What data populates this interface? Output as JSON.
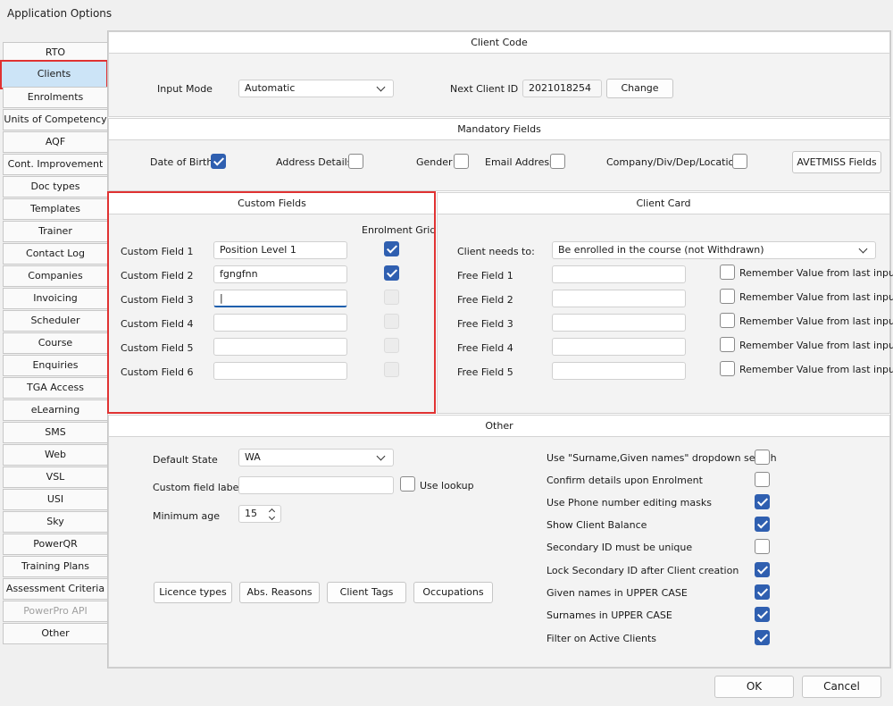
{
  "window": {
    "title": "Application Options"
  },
  "sidebar": {
    "items": [
      {
        "label": "RTO"
      },
      {
        "label": "Clients"
      },
      {
        "label": "Enrolments"
      },
      {
        "label": "Units of Competency"
      },
      {
        "label": "AQF"
      },
      {
        "label": "Cont. Improvement"
      },
      {
        "label": "Doc types"
      },
      {
        "label": "Templates"
      },
      {
        "label": "Trainer"
      },
      {
        "label": "Contact Log"
      },
      {
        "label": "Companies"
      },
      {
        "label": "Invoicing"
      },
      {
        "label": "Scheduler"
      },
      {
        "label": "Course"
      },
      {
        "label": "Enquiries"
      },
      {
        "label": "TGA Access"
      },
      {
        "label": "eLearning"
      },
      {
        "label": "SMS"
      },
      {
        "label": "Web"
      },
      {
        "label": "VSL"
      },
      {
        "label": "USI"
      },
      {
        "label": "Sky"
      },
      {
        "label": "PowerQR"
      },
      {
        "label": "Training Plans"
      },
      {
        "label": "Assessment Criteria"
      },
      {
        "label": "PowerPro API"
      },
      {
        "label": "Other"
      }
    ],
    "active": "Clients",
    "disabled": "PowerPro API"
  },
  "client_code": {
    "title": "Client Code",
    "input_mode_label": "Input Mode",
    "input_mode_value": "Automatic",
    "next_id_label": "Next Client ID",
    "next_id_value": "2021018254",
    "change_button": "Change"
  },
  "mandatory": {
    "title": "Mandatory Fields",
    "fields": [
      {
        "label": "Date of Birth",
        "checked": true
      },
      {
        "label": "Address Details",
        "checked": false
      },
      {
        "label": "Gender",
        "checked": false
      },
      {
        "label": "Email Address",
        "checked": false
      },
      {
        "label": "Company/Div/Dep/Location",
        "checked": false
      }
    ],
    "avetmiss_button": "AVETMISS Fields"
  },
  "custom_fields": {
    "title": "Custom Fields",
    "enrolment_grid_label": "Enrolment Grid",
    "rows": [
      {
        "label": "Custom Field 1",
        "value": "Position Level 1",
        "grid": true
      },
      {
        "label": "Custom Field 2",
        "value": "fgngfnn",
        "grid": true
      },
      {
        "label": "Custom Field 3",
        "value": "|",
        "grid": false
      },
      {
        "label": "Custom Field 4",
        "value": "",
        "grid": false
      },
      {
        "label": "Custom Field 5",
        "value": "",
        "grid": false
      },
      {
        "label": "Custom Field 6",
        "value": "",
        "grid": false
      }
    ]
  },
  "client_card": {
    "title": "Client Card",
    "needs_label": "Client needs to:",
    "needs_value": "Be enrolled in the course (not Withdrawn)",
    "remember_label": "Remember Value from last input",
    "free_fields": [
      {
        "label": "Free Field 1"
      },
      {
        "label": "Free Field 2"
      },
      {
        "label": "Free Field 3"
      },
      {
        "label": "Free Field 4"
      },
      {
        "label": "Free Field 5"
      }
    ]
  },
  "other": {
    "title": "Other",
    "default_state_label": "Default State",
    "default_state_value": "WA",
    "custom_field_label": "Custom field label",
    "use_lookup_label": "Use lookup",
    "minimum_age_label": "Minimum age",
    "minimum_age_value": "15",
    "buttons": {
      "licence": "Licence types",
      "abs": "Abs. Reasons",
      "tags": "Client Tags",
      "occupations": "Occupations"
    },
    "options": [
      {
        "label": "Use \"Surname,Given names\" dropdown search",
        "checked": false
      },
      {
        "label": "Confirm details upon Enrolment",
        "checked": false
      },
      {
        "label": "Use Phone number editing masks",
        "checked": true
      },
      {
        "label": "Show Client Balance",
        "checked": true
      },
      {
        "label": "Secondary ID must be unique",
        "checked": false
      },
      {
        "label": "Lock Secondary ID after Client creation",
        "checked": true
      },
      {
        "label": "Given names in UPPER CASE",
        "checked": true
      },
      {
        "label": "Surnames in UPPER CASE",
        "checked": true
      },
      {
        "label": "Filter on Active Clients",
        "checked": true
      }
    ]
  },
  "footer": {
    "ok": "OK",
    "cancel": "Cancel"
  },
  "colors": {
    "accent": "#2f5fb0",
    "highlight": "#e03232",
    "active_tab": "#cce4f7"
  }
}
